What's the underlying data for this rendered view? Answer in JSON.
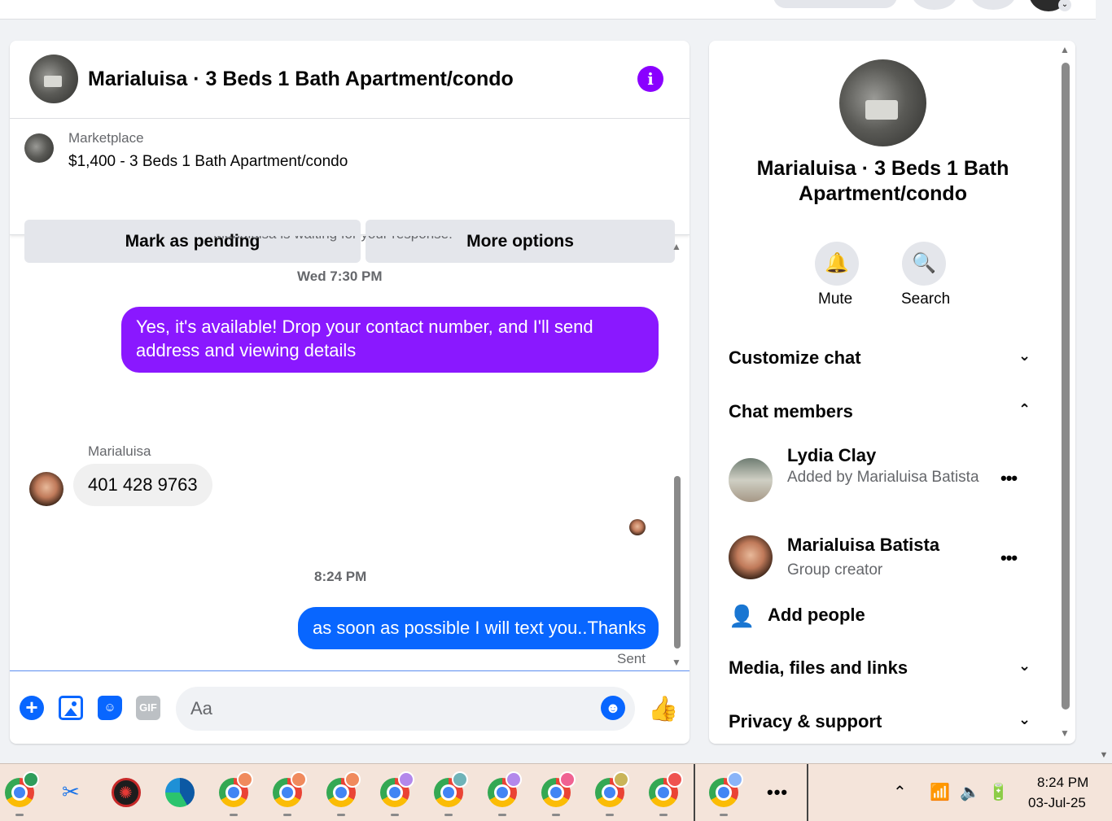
{
  "conversation": {
    "title": "Marialuisa · 3 Beds 1 Bath Apartment/condo",
    "info_icon": "info-icon"
  },
  "listing": {
    "source": "Marketplace",
    "price_title": "$1,400 - 3 Beds 1 Bath Apartment/condo",
    "mark_pending_label": "Mark as pending",
    "more_options_label": "More options"
  },
  "messages": {
    "cut_off_text": "Marialuisa is waiting for your response.",
    "timestamp_1": "Wed 7:30 PM",
    "outgoing_1": "Yes, it's available! Drop your contact number, and I'll send address and viewing details",
    "sender_name": "Marialuisa",
    "incoming_1": "401 428 9763",
    "timestamp_2": "8:24 PM",
    "outgoing_2": "as soon as possible I will text you..Thanks",
    "status": "Sent"
  },
  "composer": {
    "placeholder": "Aa",
    "icons": [
      "plus-icon",
      "photo-icon",
      "sticker-icon",
      "gif-icon",
      "emoji-icon",
      "thumbs-up-icon"
    ],
    "gif_label": "GIF"
  },
  "info_panel": {
    "title": "Marialuisa · 3 Beds 1 Bath Apartment/condo",
    "mute_label": "Mute",
    "search_label": "Search",
    "customize_chat": "Customize chat",
    "chat_members": "Chat members",
    "members": [
      {
        "name": "Lydia Clay",
        "subtitle": "Added by Marialuisa Batista"
      },
      {
        "name": "Marialuisa Batista",
        "subtitle": "Group creator"
      }
    ],
    "add_people": "Add people",
    "media_files_links": "Media, files and links",
    "privacy_support": "Privacy & support"
  },
  "taskbar": {
    "time": "8:24 PM",
    "date": "03-Jul-25",
    "chrome_profile_badge_colors": [
      "#2e9d5b",
      "#f08a5d",
      "#f08a5d",
      "#f08a5d",
      "#b388eb",
      "#6fb3b8",
      "#b388eb",
      "#f06292",
      "#c9b458",
      "#ef5350",
      "#8ab4f8"
    ]
  },
  "colors": {
    "outgoing_purple": "#8a18ff",
    "outgoing_blue": "#0866ff",
    "accent": "#0866ff"
  }
}
